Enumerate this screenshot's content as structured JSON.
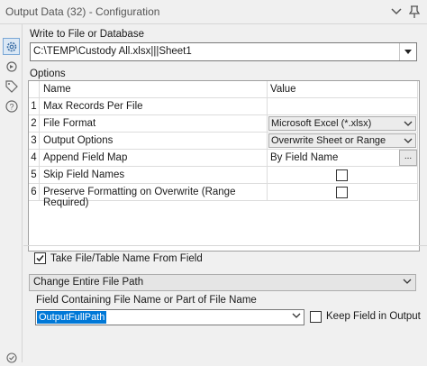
{
  "window": {
    "title": "Output Data (32) - Configuration"
  },
  "config": {
    "write_label": "Write to File or Database",
    "path_value": "C:\\TEMP\\Custody All.xlsx|||Sheet1",
    "options_label": "Options",
    "grid": {
      "col_name": "Name",
      "col_value": "Value",
      "rows": [
        {
          "num": "1",
          "name": "Max Records Per File",
          "value": ""
        },
        {
          "num": "2",
          "name": "File Format",
          "value": "Microsoft Excel (*.xlsx)"
        },
        {
          "num": "3",
          "name": "Output Options",
          "value": "Overwrite Sheet or Range"
        },
        {
          "num": "4",
          "name": "Append Field Map",
          "value": "By Field Name",
          "button": "..."
        },
        {
          "num": "5",
          "name": "Skip Field Names",
          "checked": false
        },
        {
          "num": "6",
          "name": "Preserve Formatting on Overwrite (Range Required)",
          "checked": false
        }
      ]
    },
    "take_name_label": "Take File/Table Name From Field",
    "take_name_checked": true,
    "change_mode_value": "Change Entire File Path",
    "field_label": "Field Containing File Name or Part of File Name",
    "field_value": "OutputFullPath",
    "keep_field_label": "Keep Field in Output",
    "keep_field_checked": false
  },
  "colors": {
    "accent": "#0078d7",
    "panel_bg": "#f0f0f0"
  }
}
